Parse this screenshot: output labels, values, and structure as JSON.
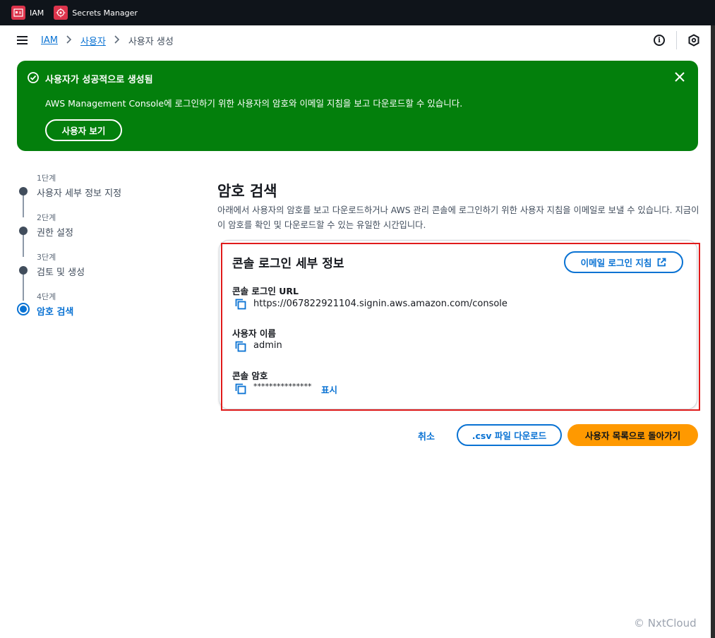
{
  "topbar": {
    "services": [
      {
        "label": "IAM",
        "icon": "iam-icon"
      },
      {
        "label": "Secrets Manager",
        "icon": "secrets-manager-icon"
      }
    ]
  },
  "breadcrumb": {
    "items": [
      "IAM",
      "사용자"
    ],
    "current": "사용자 생성"
  },
  "flash": {
    "title": "사용자가 성공적으로 생성됨",
    "body": "AWS Management Console에 로그인하기 위한 사용자의 암호와 이메일 지침을 보고 다운로드할 수 있습니다.",
    "button": "사용자 보기",
    "color": "#037f0c"
  },
  "steps": [
    {
      "num": "1단계",
      "label": "사용자 세부 정보 지정"
    },
    {
      "num": "2단계",
      "label": "권한 설정"
    },
    {
      "num": "3단계",
      "label": "검토 및 생성"
    },
    {
      "num": "4단계",
      "label": "암호 검색"
    }
  ],
  "main": {
    "title": "암호 검색",
    "description": "아래에서 사용자의 암호를 보고 다운로드하거나 AWS 관리 콘솔에 로그인하기 위한 사용자 지침을 이메일로 보낼 수 있습니다. 지금이 이 암호를 확인 및 다운로드할 수 있는 유일한 시간입니다."
  },
  "card": {
    "title": "콘솔 로그인 세부 정보",
    "email_button": "이메일 로그인 지침",
    "fields": [
      {
        "label": "콘솔 로그인 URL",
        "value": "https://067822921104.signin.aws.amazon.com/console"
      },
      {
        "label": "사용자 이름",
        "value": "admin"
      },
      {
        "label": "콘솔 암호",
        "value": "***************"
      }
    ],
    "show_label": "표시"
  },
  "actions": {
    "cancel": "취소",
    "download_csv": ".csv 파일 다운로드",
    "return": "사용자 목록으로 돌아가기"
  },
  "watermark": "© NxtCloud",
  "colors": {
    "link": "#0972d3",
    "primary_button": "#ff9900",
    "highlight": "#e01b1b",
    "topbar": "#0f141a"
  }
}
